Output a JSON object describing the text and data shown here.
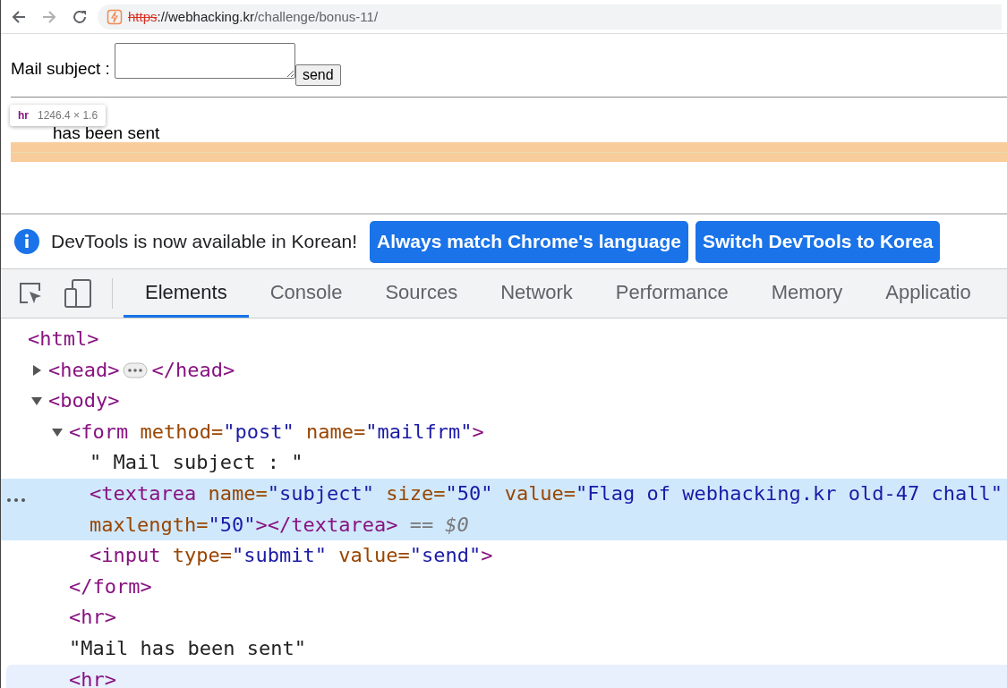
{
  "browser": {
    "back": {
      "disabled": false
    },
    "forward": {
      "disabled": true
    },
    "url": {
      "scheme": "https",
      "host": "://webhacking.kr",
      "path": "/challenge/bonus-11/",
      "insecure": true
    }
  },
  "page": {
    "label": "Mail subject :",
    "send_button": "send",
    "message": "has been sent",
    "tooltip": {
      "tag": "hr",
      "size": "1246.4 × 1.6"
    }
  },
  "infobar": {
    "message": "DevTools is now available in Korean!",
    "buttons": [
      "Always match Chrome's language",
      "Switch DevTools to Korea"
    ]
  },
  "devtools": {
    "tabs": [
      {
        "label": "Elements",
        "selected": true
      },
      {
        "label": "Console",
        "selected": false
      },
      {
        "label": "Sources",
        "selected": false
      },
      {
        "label": "Network",
        "selected": false
      },
      {
        "label": "Performance",
        "selected": false
      },
      {
        "label": "Memory",
        "selected": false
      },
      {
        "label": "Applicatio",
        "selected": false
      }
    ],
    "tree": [
      {
        "lines": [
          [
            {
              "kind": "tag",
              "t": "<html>"
            }
          ]
        ],
        "selected": false,
        "hovered": false,
        "children": [
          {
            "lines": [
              [
                {
                  "kind": "tag",
                  "t": "<head>"
                },
                {
                  "kind": "badge"
                },
                {
                  "kind": "tag",
                  "t": "</head>"
                }
              ]
            ],
            "expanded": false,
            "selected": false,
            "hovered": false
          },
          {
            "lines": [
              [
                {
                  "kind": "tag",
                  "t": "<body>"
                }
              ]
            ],
            "expanded": true,
            "selected": false,
            "hovered": false,
            "children": [
              {
                "lines": [
                  [
                    {
                      "kind": "tag",
                      "t": "<form"
                    },
                    {
                      "kind": "attr",
                      "t": " method="
                    },
                    {
                      "kind": "val",
                      "t": "\"post\""
                    },
                    {
                      "kind": "attr",
                      "t": " name="
                    },
                    {
                      "kind": "val",
                      "t": "\"mailfrm\""
                    },
                    {
                      "kind": "tag",
                      "t": ">"
                    }
                  ]
                ],
                "expanded": true,
                "selected": false,
                "hovered": false,
                "closing": "</form>",
                "children": [
                  {
                    "lines": [
                      [
                        {
                          "kind": "text",
                          "t": "\" Mail subject : \""
                        }
                      ]
                    ],
                    "selected": false,
                    "hovered": false
                  },
                  {
                    "lines": [
                      [
                        {
                          "kind": "tag",
                          "t": "<textarea"
                        },
                        {
                          "kind": "attr",
                          "t": " name="
                        },
                        {
                          "kind": "val",
                          "t": "\"subject\""
                        },
                        {
                          "kind": "attr",
                          "t": " size="
                        },
                        {
                          "kind": "val",
                          "t": "\"50\""
                        },
                        {
                          "kind": "attr",
                          "t": " value="
                        },
                        {
                          "kind": "val",
                          "t": "\"Flag of webhacking.kr old-47 chall\""
                        }
                      ],
                      [
                        {
                          "kind": "attr",
                          "t": "maxlength="
                        },
                        {
                          "kind": "val",
                          "t": "\"50\""
                        },
                        {
                          "kind": "tag",
                          "t": "></textarea>"
                        },
                        {
                          "kind": "ref",
                          "t": " == $0"
                        }
                      ]
                    ],
                    "selected": true,
                    "hovered": false
                  },
                  {
                    "lines": [
                      [
                        {
                          "kind": "tag",
                          "t": "<input"
                        },
                        {
                          "kind": "attr",
                          "t": " type="
                        },
                        {
                          "kind": "val",
                          "t": "\"submit\""
                        },
                        {
                          "kind": "attr",
                          "t": " value="
                        },
                        {
                          "kind": "val",
                          "t": "\"send\""
                        },
                        {
                          "kind": "tag",
                          "t": ">"
                        }
                      ]
                    ],
                    "selected": false,
                    "hovered": false
                  }
                ]
              },
              {
                "lines": [
                  [
                    {
                      "kind": "tag",
                      "t": "<hr>"
                    }
                  ]
                ],
                "selected": false,
                "hovered": false
              },
              {
                "lines": [
                  [
                    {
                      "kind": "text",
                      "t": "\"Mail has been sent\""
                    }
                  ]
                ],
                "selected": false,
                "hovered": false
              },
              {
                "lines": [
                  [
                    {
                      "kind": "tag",
                      "t": "<hr>"
                    }
                  ]
                ],
                "selected": false,
                "hovered": true
              }
            ]
          }
        ]
      }
    ]
  }
}
